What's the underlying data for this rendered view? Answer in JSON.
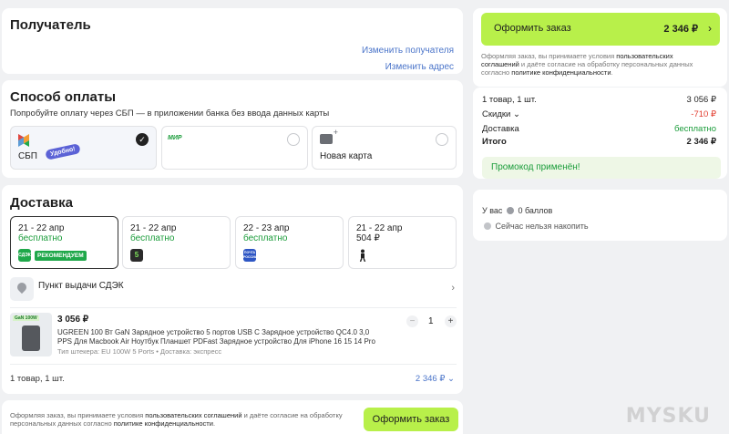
{
  "recipient": {
    "title": "Получатель",
    "change_recipient": "Изменить получателя",
    "change_address": "Изменить адрес"
  },
  "payment": {
    "title": "Способ оплаты",
    "hint": "Попробуйте оплату через СБП — в приложении банка без ввода данных карты",
    "options": [
      {
        "label": "СБП",
        "badge": "Удобно!",
        "selected": true
      },
      {
        "label": "",
        "brand": "МИР",
        "selected": false
      },
      {
        "label": "Новая карта",
        "selected": false
      }
    ],
    "check": "✓"
  },
  "delivery": {
    "title": "Доставка",
    "options": [
      {
        "date": "21 - 22 апр",
        "cost": "бесплатно",
        "logo": "СДЭК",
        "logo_color": "#1fa84a",
        "badge": "РЕКОМЕНДУЕМ"
      },
      {
        "date": "21 - 22 апр",
        "cost": "бесплатно",
        "logo": "5",
        "logo_color": "#2b2b2b"
      },
      {
        "date": "22 - 23 апр",
        "cost": "бесплатно",
        "logo": "ПОЧТА РОССИИ",
        "logo_color": "#2e56c4"
      },
      {
        "date": "21 - 22 апр",
        "cost": "504 ₽",
        "logo": "courier-icon",
        "logo_color": "#ffffff"
      }
    ],
    "pickup_point": "Пункт выдачи СДЭК",
    "product": {
      "image_label": "GaN 100W",
      "price": "3 056 ₽",
      "title": "UGREEN 100 Вт GaN Зарядное устройство 5 портов USB C Зарядное устройство QC4.0 3,0 PPS Для Macbook Air Ноутбук Планшет PDFast Зарядное устройство Для iPhone 16 15 14 Pro",
      "meta": "Тип штекера: EU 100W 5 Ports • Доставка: экспресс",
      "qty": "1",
      "minus": "−",
      "plus": "+"
    },
    "footer_count": "1 товар, 1 шт.",
    "footer_total": "2 346 ₽"
  },
  "bottom_bar": {
    "legal_prefix": "Оформляя заказ, вы принимаете условия ",
    "legal_link1": "пользовательских соглашений",
    "legal_mid": " и даёте согласие на обработку персональных данных согласно ",
    "legal_link2": "политике конфиденциальности",
    "legal_suffix": ".",
    "button": "Оформить заказ"
  },
  "checkout": {
    "button_label": "Оформить заказ",
    "button_total": "2 346 ₽",
    "legal_prefix": "Оформляя заказ, вы принимаете условия ",
    "legal_link1": "пользовательских соглашений",
    "legal_mid": " и даёте согласие на обработку персональных данных согласно ",
    "legal_link2": "политике конфиденциальности",
    "legal_suffix": "."
  },
  "summary": {
    "items_label": "1 товар, 1 шт.",
    "items_value": "3 056 ₽",
    "discount_label": "Скидки",
    "discount_value": "-710 ₽",
    "delivery_label": "Доставка",
    "delivery_value": "бесплатно",
    "total_label": "Итого",
    "total_value": "2 346 ₽",
    "promo": "Промокод применён!"
  },
  "bonus": {
    "prefix": "У вас",
    "points": "0 баллов",
    "note": "Сейчас нельзя накопить"
  },
  "watermark": "MYSKU",
  "colors": {
    "accent_green": "#b8f04a",
    "success": "#1a9c3a",
    "discount": "#e23b2d",
    "link": "#4a74c9"
  }
}
